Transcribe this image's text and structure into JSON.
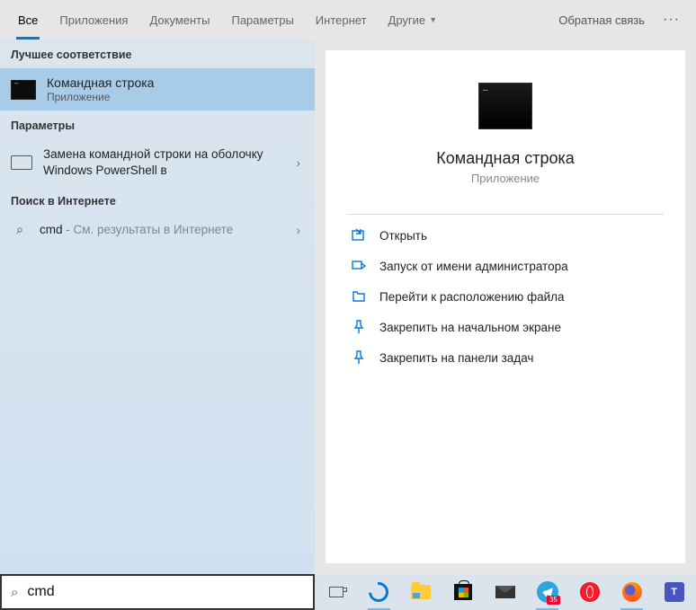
{
  "tabs": {
    "all": "Все",
    "apps": "Приложения",
    "docs": "Документы",
    "params": "Параметры",
    "internet": "Интернет",
    "other": "Другие"
  },
  "feedback": "Обратная связь",
  "left": {
    "best_match": "Лучшее соответствие",
    "result_title": "Командная строка",
    "result_sub": "Приложение",
    "params_h": "Параметры",
    "param1": "Замена командной строки на оболочку Windows PowerShell в",
    "web_h": "Поиск в Интернете",
    "web_q": "cmd",
    "web_hint": " - См. результаты в Интернете"
  },
  "preview": {
    "title": "Командная строка",
    "sub": "Приложение"
  },
  "actions": {
    "open": "Открыть",
    "admin": "Запуск от имени администратора",
    "loc": "Перейти к расположению файла",
    "pin_start": "Закрепить на начальном экране",
    "pin_task": "Закрепить на панели задач"
  },
  "search": {
    "value": "cmd"
  },
  "taskbar": {
    "badge": "35"
  }
}
